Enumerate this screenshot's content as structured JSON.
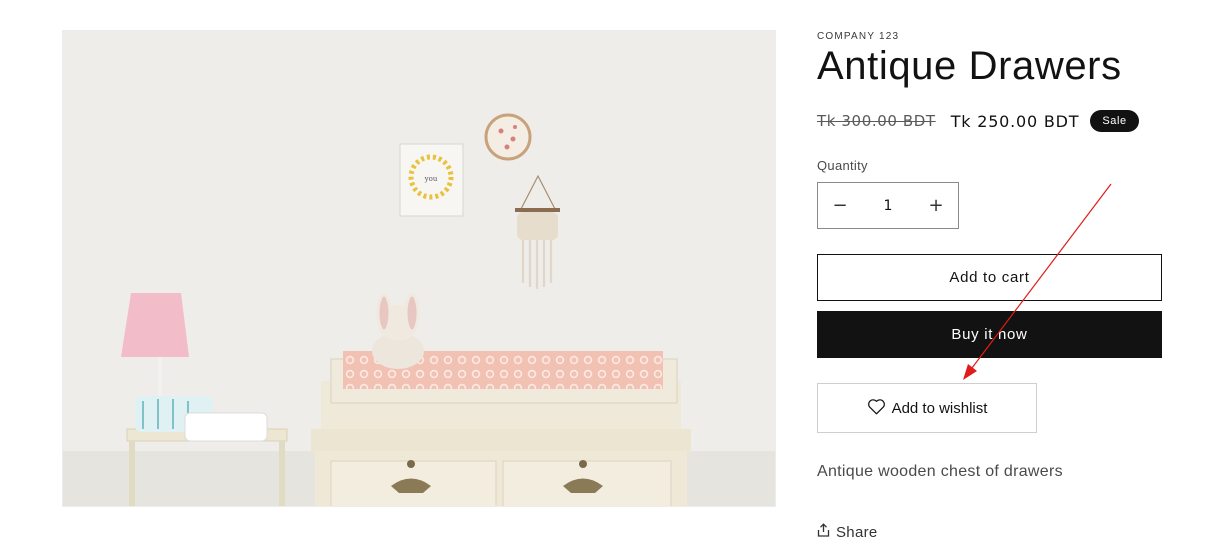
{
  "product": {
    "vendor": "COMPANY 123",
    "title": "Antique Drawers",
    "price_regular": "Tk 300.00 BDT",
    "price_sale": "Tk 250.00 BDT",
    "badge": "Sale",
    "image_alt": "Antique Drawers",
    "quantity_label": "Quantity",
    "quantity_value": "1",
    "decrease_symbol": "−",
    "increase_symbol": "+",
    "add_to_cart_label": "Add to cart",
    "buy_now_label": "Buy it now",
    "wishlist_label": "Add to wishlist",
    "description": "Antique wooden chest of drawers",
    "share_label": "Share"
  },
  "icons": {
    "wishlist": "heart-icon",
    "share": "share-icon"
  },
  "colors": {
    "primary": "#121212",
    "annotation_arrow": "#e11b1b",
    "badge_bg": "#121212"
  }
}
